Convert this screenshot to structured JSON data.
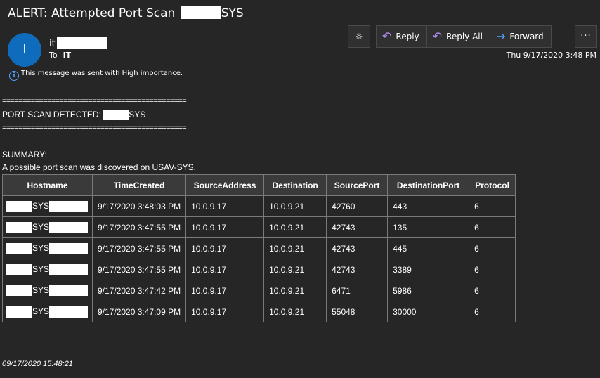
{
  "header": {
    "subject_prefix": "ALERT: Attempted Port Scan",
    "subject_suffix": "SYS",
    "avatar_initial": "I",
    "sender_name": "it",
    "to_label": "To",
    "to_value": "IT",
    "importance_note": "This message was sent with High importance.",
    "date": "Thu 9/17/2020 3:48 PM"
  },
  "toolbar": {
    "reply_label": "Reply",
    "reply_all_label": "Reply All",
    "forward_label": "Forward",
    "more_label": "···",
    "sun_icon": "☼"
  },
  "body": {
    "separator": "=============================================",
    "detected_label": "PORT SCAN DETECTED:",
    "detected_suffix": "SYS",
    "summary_label": "SUMMARY:",
    "summary_text": "A possible port scan was discovered on USAV-SYS."
  },
  "table": {
    "columns": [
      "Hostname",
      "TimeCreated",
      "SourceAddress",
      "Destination",
      "SourcePort",
      "DestinationPort",
      "Protocol"
    ],
    "rows": [
      {
        "host_mid": "SYS",
        "time": "9/17/2020 3:48:03 PM",
        "src": "10.0.9.17",
        "dst": "10.0.9.21",
        "sport": "42760",
        "dport": "443",
        "proto": "6"
      },
      {
        "host_mid": "SYS",
        "time": "9/17/2020 3:47:55 PM",
        "src": "10.0.9.17",
        "dst": "10.0.9.21",
        "sport": "42743",
        "dport": "135",
        "proto": "6"
      },
      {
        "host_mid": "SYS",
        "time": "9/17/2020 3:47:55 PM",
        "src": "10.0.9.17",
        "dst": "10.0.9.21",
        "sport": "42743",
        "dport": "445",
        "proto": "6"
      },
      {
        "host_mid": "SYS",
        "time": "9/17/2020 3:47:55 PM",
        "src": "10.0.9.17",
        "dst": "10.0.9.21",
        "sport": "42743",
        "dport": "3389",
        "proto": "6"
      },
      {
        "host_mid": "SYS",
        "time": "9/17/2020 3:47:42 PM",
        "src": "10.0.9.17",
        "dst": "10.0.9.21",
        "sport": "6471",
        "dport": "5986",
        "proto": "6"
      },
      {
        "host_mid": "SYS",
        "time": "9/17/2020 3:47:09 PM",
        "src": "10.0.9.17",
        "dst": "10.0.9.21",
        "sport": "55048",
        "dport": "30000",
        "proto": "6"
      }
    ]
  },
  "footer": {
    "timestamp": "09/17/2020 15:48:21"
  }
}
